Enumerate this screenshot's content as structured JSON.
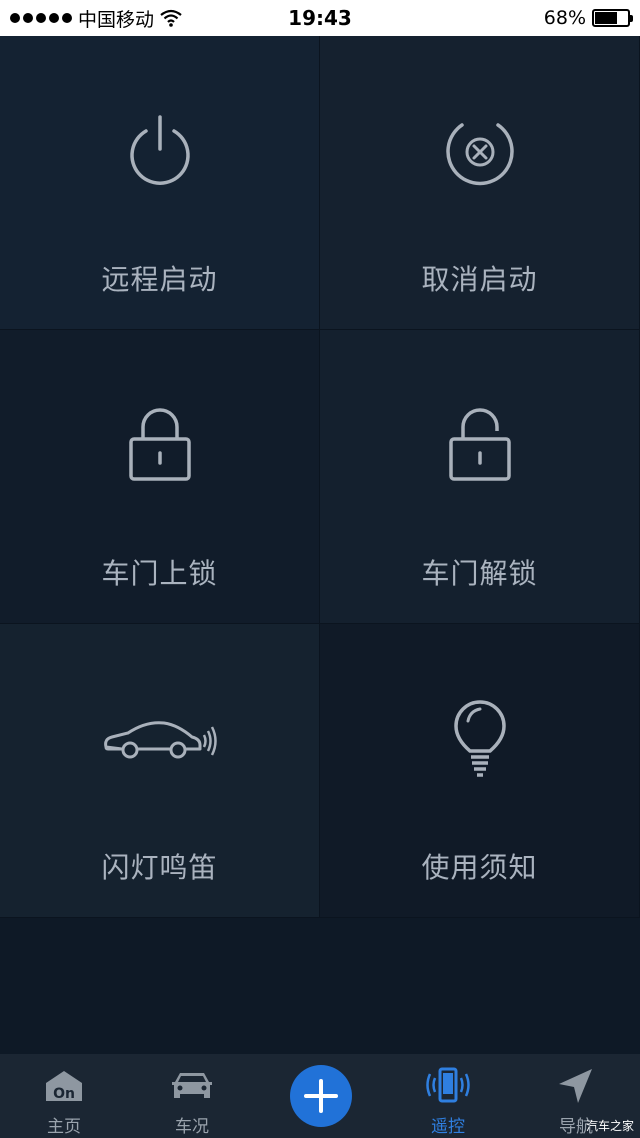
{
  "status_bar": {
    "carrier": "中国移动",
    "time": "19:43",
    "battery": "68%",
    "battery_level": 0.68
  },
  "controls": [
    {
      "label": "远程启动",
      "icon": "power-icon"
    },
    {
      "label": "取消启动",
      "icon": "cancel-circle-icon"
    },
    {
      "label": "车门上锁",
      "icon": "lock-icon"
    },
    {
      "label": "车门解锁",
      "icon": "unlock-icon"
    },
    {
      "label": "闪灯鸣笛",
      "icon": "car-horn-icon"
    },
    {
      "label": "使用须知",
      "icon": "lightbulb-icon"
    }
  ],
  "tab_bar": {
    "tabs": [
      {
        "label": "主页",
        "icon": "home-onstar-icon"
      },
      {
        "label": "车况",
        "icon": "car-icon"
      },
      {
        "label": "遥控",
        "icon": "remote-phone-icon",
        "active": true
      },
      {
        "label": "导航",
        "icon": "navigation-arrow-icon"
      }
    ],
    "fab_icon": "plus-icon"
  },
  "watermark": "汽车之家",
  "colors": {
    "background": "#0f1b29",
    "accent": "#2172d8",
    "icon_stroke": "#a9b1bb",
    "label_text": "#aab3bf",
    "tab_active": "#2f7fe0"
  }
}
